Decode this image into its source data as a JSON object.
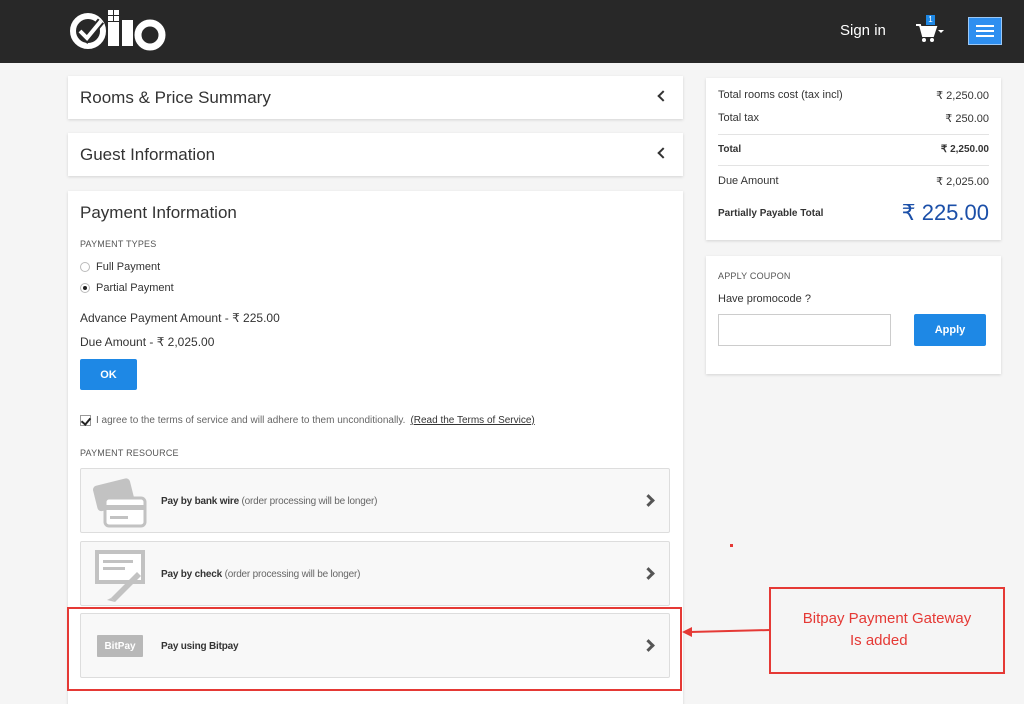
{
  "header": {
    "logo_text": "Qlo",
    "signin_label": "Sign in",
    "cart_count": "1",
    "brand_color": "#282828",
    "accent_color": "#1e88e5"
  },
  "sections": {
    "rooms_summary_title": "Rooms & Price Summary",
    "guest_info_title": "Guest Information"
  },
  "payment": {
    "title": "Payment Information",
    "types_label": "PAYMENT TYPES",
    "types": [
      {
        "label": "Full Payment",
        "selected": false
      },
      {
        "label": "Partial Payment",
        "selected": true
      }
    ],
    "advance_amount": "Advance Payment Amount - ₹ 225.00",
    "due_amount": "Due Amount - ₹ 2,025.00",
    "ok_label": "OK",
    "terms_text": "I agree to the terms of service and will adhere to them unconditionally.",
    "terms_link": "(Read the Terms of Service)",
    "terms_checked": true,
    "resource_label": "PAYMENT RESOURCE",
    "methods": [
      {
        "title": "Pay by bank wire",
        "note": "(order processing will be longer)",
        "icon": "credit-card-icon"
      },
      {
        "title": "Pay by check",
        "note": "(order processing will be longer)",
        "icon": "check-pen-icon"
      },
      {
        "title": "Pay using Bitpay",
        "note": "",
        "icon": "bitpay-logo",
        "badge": "BitPay"
      }
    ]
  },
  "summary": {
    "rows": [
      {
        "label": "Total rooms cost (tax incl)",
        "value": "₹ 2,250.00"
      },
      {
        "label": "Total tax",
        "value": "₹ 250.00"
      }
    ],
    "total_label": "Total",
    "total_value": "₹ 2,250.00",
    "due_label": "Due Amount",
    "due_value": "₹ 2,025.00",
    "partial_label": "Partially Payable Total",
    "partial_value": "₹ 225.00"
  },
  "coupon": {
    "title": "APPLY COUPON",
    "prompt": "Have promocode ?",
    "input_value": "",
    "apply_label": "Apply"
  },
  "annotation": {
    "line1": "Bitpay Payment Gateway",
    "line2": "Is added",
    "color": "#e53935"
  }
}
